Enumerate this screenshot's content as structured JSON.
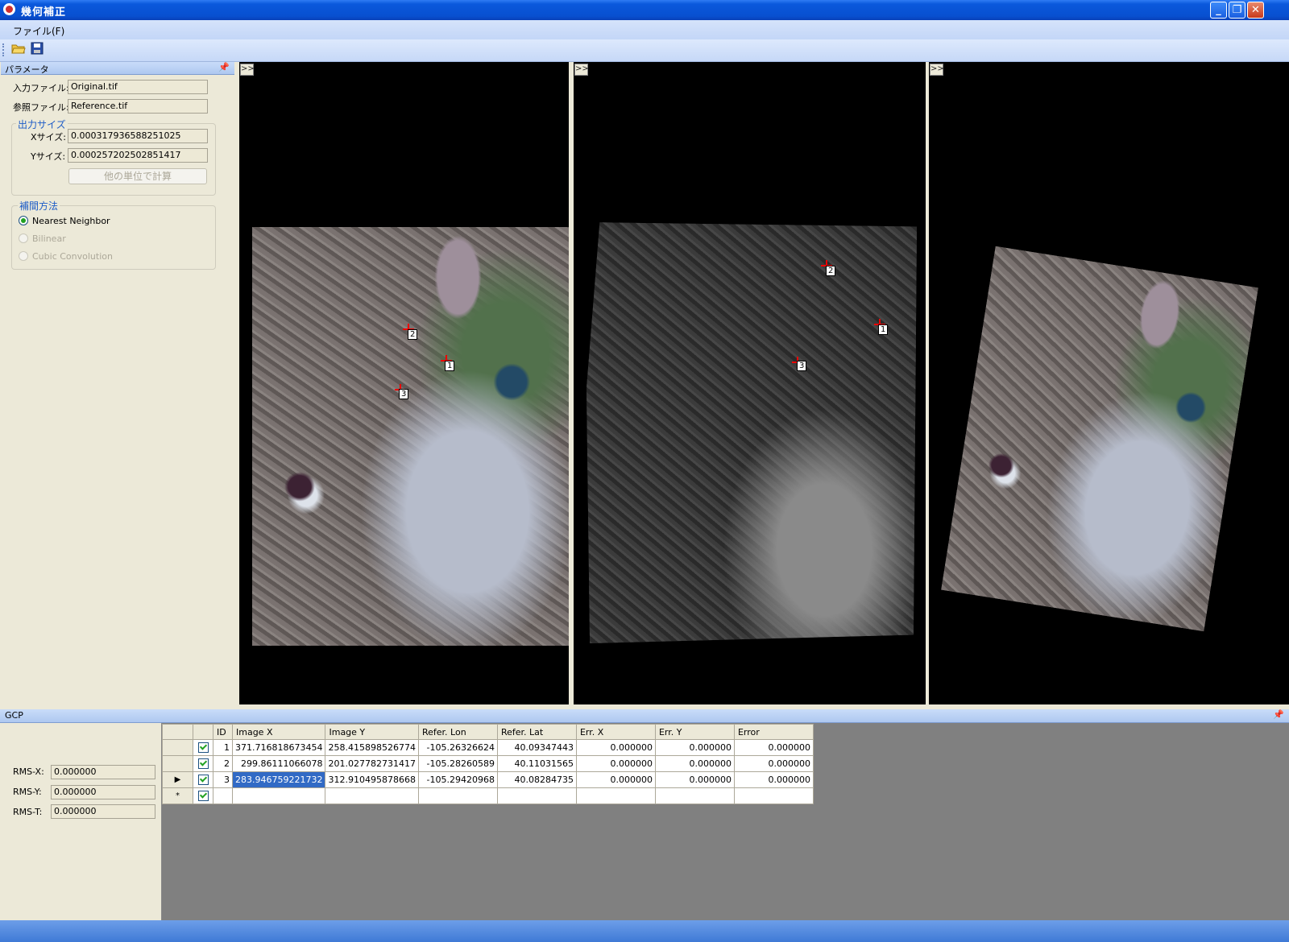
{
  "window": {
    "title": "幾何補正"
  },
  "menu": {
    "items": [
      "ファイル(F)"
    ]
  },
  "toolbar": {
    "icons": [
      "open-folder-icon",
      "save-icon"
    ]
  },
  "param_panel": {
    "title": "パラメータ",
    "input_file_label": "入力ファイル:",
    "input_file_value": "Original.tif",
    "ref_file_label": "参照ファイル:",
    "ref_file_value": "Reference.tif",
    "output_size": {
      "title": "出力サイズ",
      "x_label": "Xサイズ:",
      "x_value": "0.000317936588251025",
      "y_label": "Yサイズ:",
      "y_value": "0.000257202502851417",
      "calc_button": "他の単位で計算"
    },
    "interp": {
      "title": "補間方法",
      "options": [
        {
          "label": "Nearest Neighbor",
          "selected": true,
          "enabled": true
        },
        {
          "label": "Bilinear",
          "selected": false,
          "enabled": false
        },
        {
          "label": "Cubic Convolution",
          "selected": false,
          "enabled": false
        }
      ]
    }
  },
  "viewers": {
    "expand_label": ">>",
    "gcp_labels": [
      "1",
      "2",
      "3"
    ]
  },
  "gcp_panel": {
    "title": "GCP",
    "rms_x_label": "RMS-X:",
    "rms_x_value": "0.000000",
    "rms_y_label": "RMS-Y:",
    "rms_y_value": "0.000000",
    "rms_t_label": "RMS-T:",
    "rms_t_value": "0.000000",
    "columns": [
      "ID",
      "Image X",
      "Image Y",
      "Refer. Lon",
      "Refer. Lat",
      "Err. X",
      "Err. Y",
      "Error"
    ],
    "rows": [
      {
        "checked": true,
        "id": "1",
        "image_x": "371.716818673454",
        "image_y": "258.415898526774",
        "lon": "-105.26326624",
        "lat": "40.09347443",
        "err_x": "0.000000",
        "err_y": "0.000000",
        "error": "0.000000"
      },
      {
        "checked": true,
        "id": "2",
        "image_x": "299.86111066078",
        "image_y": "201.027782731417",
        "lon": "-105.28260589",
        "lat": "40.11031565",
        "err_x": "0.000000",
        "err_y": "0.000000",
        "error": "0.000000"
      },
      {
        "checked": true,
        "id": "3",
        "image_x": "283.946759221732",
        "image_y": "312.910495878668",
        "lon": "-105.29420968",
        "lat": "40.08284735",
        "err_x": "0.000000",
        "err_y": "0.000000",
        "error": "0.000000"
      }
    ],
    "current_row_marker": "▶",
    "new_row_marker": "*"
  }
}
